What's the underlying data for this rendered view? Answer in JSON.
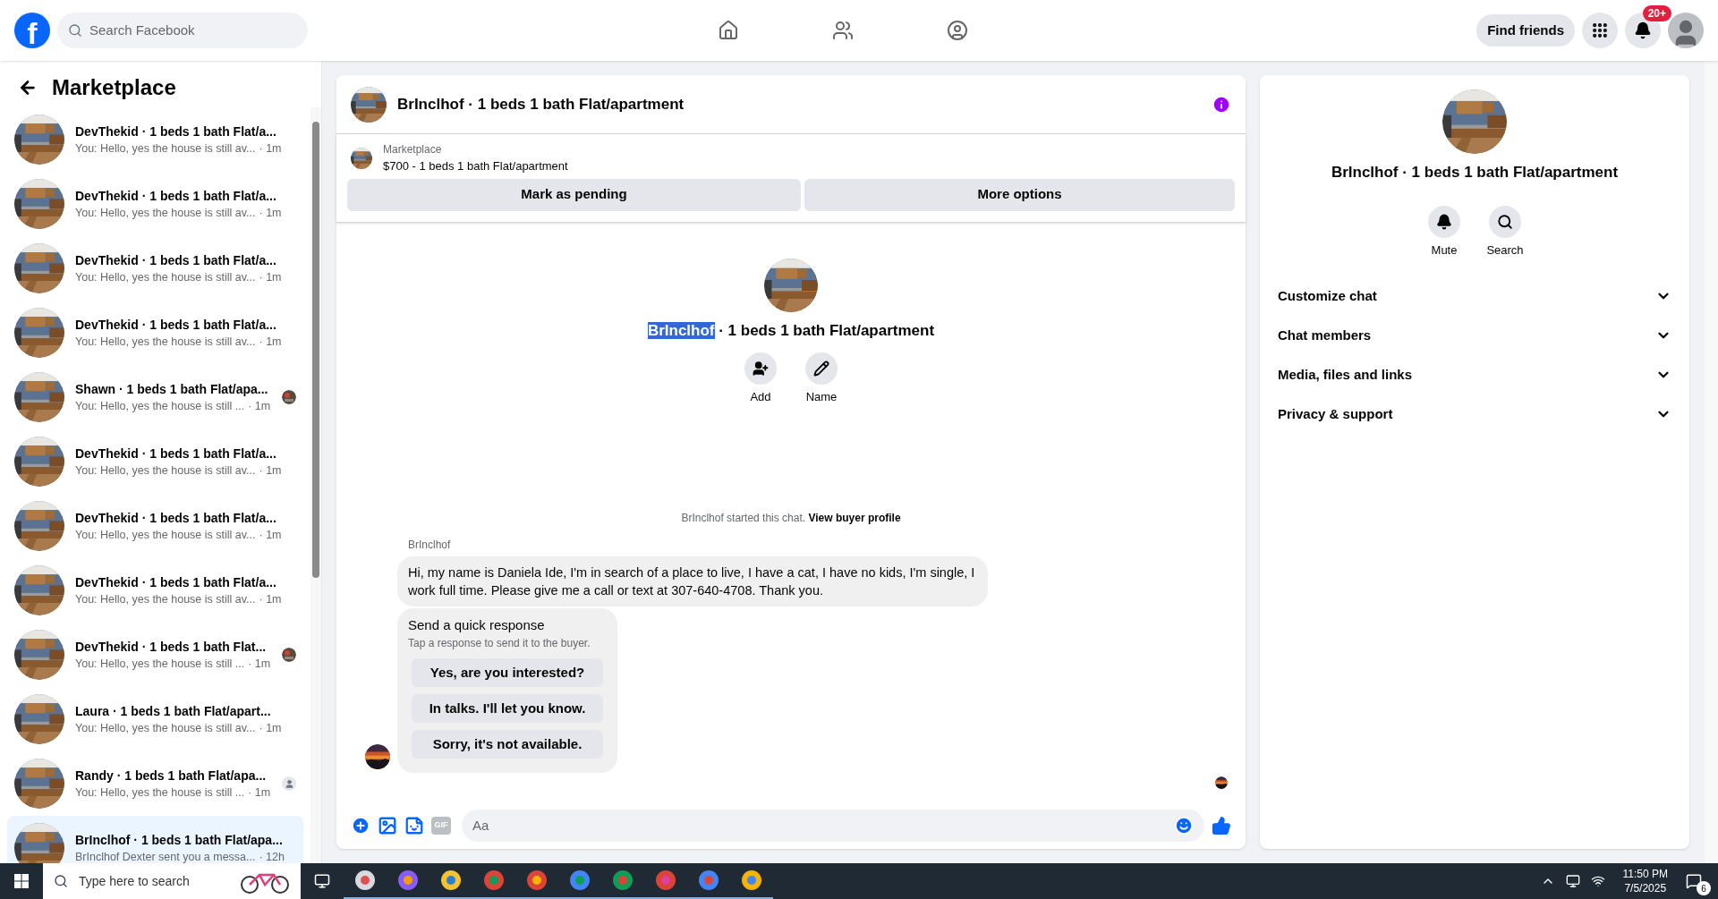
{
  "topbar": {
    "logo": "f",
    "search": {
      "placeholder": "Search Facebook"
    },
    "find_friends": "Find friends",
    "notifications_badge": "20+"
  },
  "sidebar": {
    "title": "Marketplace",
    "conversations": [
      {
        "title": "DevThekid · 1 beds 1 bath Flat/a...",
        "preview": "You: Hello, yes the house is still av...",
        "time": "· 1m",
        "selected": false,
        "kind": "plain"
      },
      {
        "title": "DevThekid · 1 beds 1 bath Flat/a...",
        "preview": "You: Hello, yes the house is still av...",
        "time": "· 1m",
        "selected": false,
        "kind": "plain"
      },
      {
        "title": "DevThekid · 1 beds 1 bath Flat/a...",
        "preview": "You: Hello, yes the house is still av...",
        "time": "· 1m",
        "selected": false,
        "kind": "plain"
      },
      {
        "title": "DevThekid · 1 beds 1 bath Flat/a...",
        "preview": "You: Hello, yes the house is still av...",
        "time": "· 1m",
        "selected": false,
        "kind": "plain"
      },
      {
        "title": "Shawn · 1 beds 1 bath Flat/apa...",
        "preview": "You: Hello, yes the house is still ...",
        "time": "· 1m",
        "selected": false,
        "kind": "seenphoto"
      },
      {
        "title": "DevThekid · 1 beds 1 bath Flat/a...",
        "preview": "You: Hello, yes the house is still av...",
        "time": "· 1m",
        "selected": false,
        "kind": "plain"
      },
      {
        "title": "DevThekid · 1 beds 1 bath Flat/a...",
        "preview": "You: Hello, yes the house is still av...",
        "time": "· 1m",
        "selected": false,
        "kind": "plain"
      },
      {
        "title": "DevThekid · 1 beds 1 bath Flat/a...",
        "preview": "You: Hello, yes the house is still av...",
        "time": "· 1m",
        "selected": false,
        "kind": "plain"
      },
      {
        "title": "DevThekid · 1 beds 1 bath Flat...",
        "preview": "You: Hello, yes the house is still ...",
        "time": "· 1m",
        "selected": false,
        "kind": "seenphoto"
      },
      {
        "title": "Laura · 1 beds 1 bath Flat/apart...",
        "preview": "You: Hello, yes the house is still av...",
        "time": "· 1m",
        "selected": false,
        "kind": "plain"
      },
      {
        "title": "Randy · 1 beds 1 bath Flat/apa...",
        "preview": "You: Hello, yes the house is still ...",
        "time": "· 1m",
        "selected": false,
        "kind": "seenavatar"
      },
      {
        "title": "BrInclhof · 1 beds 1 bath Flat/apa...",
        "preview": "BrInclhof Dexter sent you a messa...",
        "time": "· 12h",
        "selected": true,
        "kind": "plain"
      }
    ]
  },
  "chat": {
    "title": "BrInclhof · 1 beds 1 bath Flat/apartment",
    "listing": {
      "label": "Marketplace",
      "summary": "$700 - 1 beds 1 bath Flat/apartment",
      "buttons": [
        "Mark as pending",
        "More options"
      ]
    },
    "intro": {
      "title_parts": [
        {
          "text": "BrInclhof",
          "highlighted": true
        },
        {
          "text": " · 1 beds 1 bath Flat/apartment",
          "highlighted": false
        }
      ],
      "actions": [
        {
          "kind": "add",
          "label": "Add"
        },
        {
          "kind": "name",
          "label": "Name"
        }
      ]
    },
    "started": {
      "text": "BrInclhof started this chat.",
      "link": "View buyer profile"
    },
    "sender": "BrInclhof",
    "message": "Hi, my name is Daniela Ide, I'm in search of a place to live, I have a cat, I have no kids, I'm single, I work full time.  Please give me a call or text at 307-640-4708.  Thank you.",
    "quick_response": {
      "title": "Send a quick response",
      "subtitle": "Tap a response to send it to the buyer.",
      "options": [
        "Yes, are you interested?",
        "In talks. I'll let you know.",
        "Sorry, it's not available."
      ]
    },
    "composer": {
      "gif_label": "GIF",
      "placeholder": "Aa"
    }
  },
  "details": {
    "title": "BrInclhof · 1 beds 1 bath Flat/apartment",
    "actions": [
      {
        "kind": "mute",
        "label": "Mute"
      },
      {
        "kind": "search",
        "label": "Search"
      }
    ],
    "sections": [
      {
        "label": "Customize chat",
        "expanded": false
      },
      {
        "label": "Chat members",
        "expanded": false
      },
      {
        "label": "Media, files and links",
        "expanded": false
      },
      {
        "label": "Privacy & support",
        "expanded": false
      }
    ]
  },
  "taskbar": {
    "search": {
      "placeholder": "Type here to search"
    },
    "time": "11:50 PM",
    "date": "7/5/2025",
    "notification_count": "6"
  }
}
